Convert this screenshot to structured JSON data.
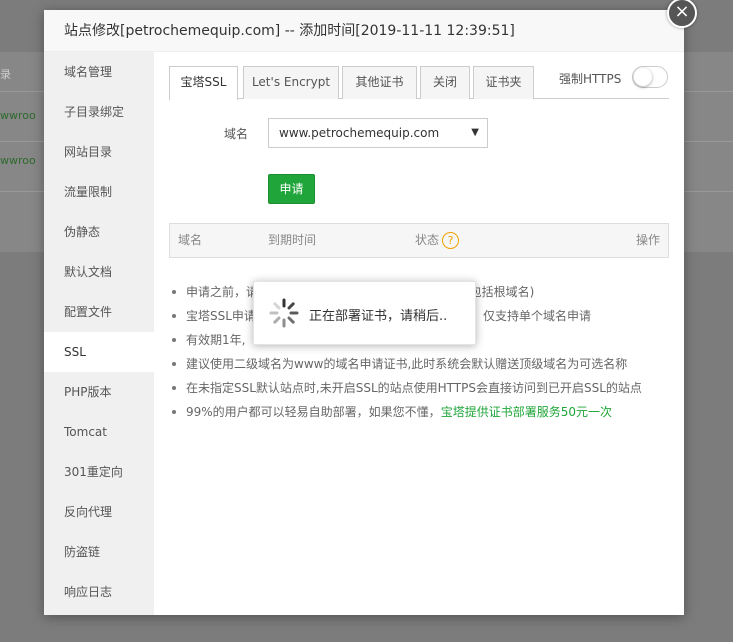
{
  "background": {
    "text_fragment": "录",
    "link_fragment_1": "wwroo",
    "link_fragment_2": "wwroo"
  },
  "modal": {
    "title": "站点修改[petrochemequip.com] -- 添加时间[2019-11-11 12:39:51]",
    "close_symbol": "×"
  },
  "sidebar": {
    "items": [
      {
        "label": "域名管理"
      },
      {
        "label": "子目录绑定"
      },
      {
        "label": "网站目录"
      },
      {
        "label": "流量限制"
      },
      {
        "label": "伪静态"
      },
      {
        "label": "默认文档"
      },
      {
        "label": "配置文件"
      },
      {
        "label": "SSL",
        "active": true
      },
      {
        "label": "PHP版本"
      },
      {
        "label": "Tomcat"
      },
      {
        "label": "301重定向"
      },
      {
        "label": "反向代理"
      },
      {
        "label": "防盗链"
      },
      {
        "label": "响应日志"
      }
    ]
  },
  "ssl": {
    "tabs": [
      {
        "label": "宝塔SSL",
        "active": true
      },
      {
        "label": "Let's Encrypt"
      },
      {
        "label": "其他证书"
      },
      {
        "label": "关闭"
      },
      {
        "label": "证书夹"
      }
    ],
    "force_https_label": "强制HTTPS",
    "force_https_on": false,
    "domain_label": "域名",
    "domain_value": "www.petrochemequip.com",
    "apply_label": "申请",
    "table_headers": {
      "domain": "域名",
      "expiry": "到期时间",
      "status": "状态",
      "action": "操作"
    },
    "help_symbol": "?",
    "tips": [
      "申请之前，请",
      "宝塔SSL申请",
      "有效期1年,",
      "建议使用二级域名为www的域名申请证书,此时系统会默认赠送顶级域名为可选名称",
      "在未指定SSL默认站点时,未开启SSL的站点使用HTTPS会直接访问到已开启SSL的站点"
    ],
    "tip_partial_1_right": "致(包括根域名)",
    "tip_partial_2_right": "书，仅支持单个域名申请",
    "tip_last_prefix": "99%的用户都可以轻易自助部署，如果您不懂，",
    "tip_last_link": "宝塔提供证书部署服务50元一次"
  },
  "loading": {
    "text": "正在部署证书，请稍后.."
  },
  "colors": {
    "accent_green": "#20a53a",
    "help_orange": "#f0a100"
  }
}
